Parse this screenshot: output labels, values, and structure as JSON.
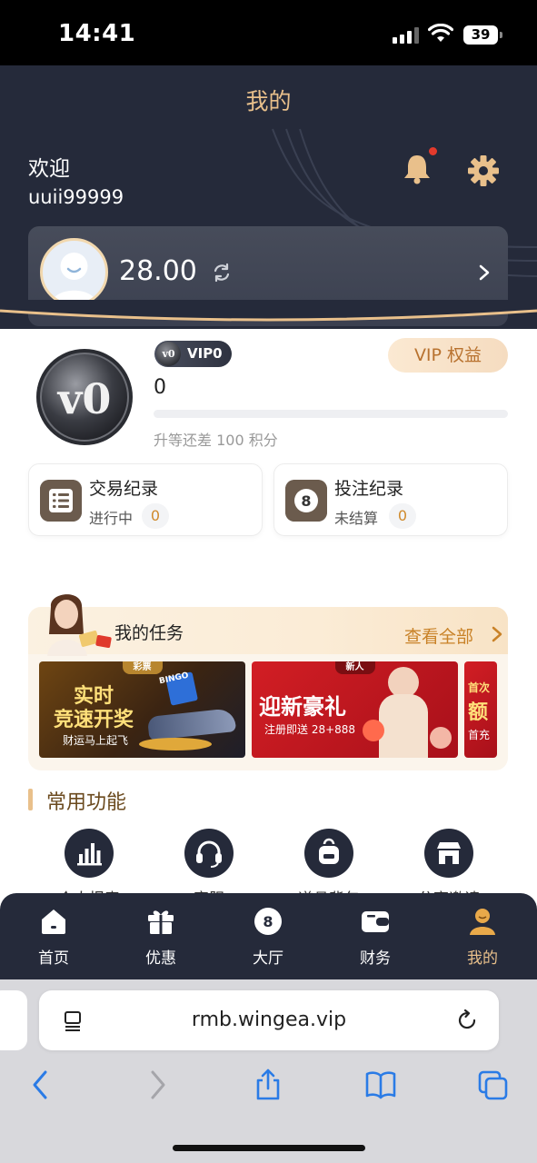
{
  "status_bar": {
    "time": "14:41",
    "battery": "39"
  },
  "header": {
    "title": "我的",
    "welcome": "欢迎",
    "username": "uuii99999",
    "balance": "28.00"
  },
  "vip": {
    "badge_level": "v0",
    "badge_label": "VIP0",
    "coin_label": "v0",
    "points": "0",
    "benefit_button": "VIP 权益",
    "progress_fraction": 0,
    "hint": "升等还差 100 积分"
  },
  "records": [
    {
      "title": "交易纪录",
      "status": "进行中",
      "count": "0"
    },
    {
      "title": "投注纪录",
      "status": "未结算",
      "count": "0"
    }
  ],
  "tasks": {
    "title": "我的任务",
    "view_all": "查看全部",
    "banners": [
      {
        "tag": "彩票",
        "line1": "实时",
        "line2": "竞速开奖",
        "sub": "财运马上起飞",
        "extra": "BINGO"
      },
      {
        "tag": "新人",
        "line1": "迎新豪礼",
        "sub": "注册即送 28+888"
      },
      {
        "tag": "首次",
        "line1": "额",
        "sub": "首充"
      }
    ]
  },
  "common_functions": {
    "title": "常用功能",
    "items": [
      {
        "icon": "chart-bar-icon",
        "label": "个人报表"
      },
      {
        "icon": "headset-icon",
        "label": "客服"
      },
      {
        "icon": "backpack-icon",
        "label": "道具背包"
      },
      {
        "icon": "shop-icon",
        "label": "分享邀请"
      }
    ]
  },
  "tabbar": {
    "items": [
      {
        "icon": "home-icon",
        "label": "首页",
        "active": false
      },
      {
        "icon": "gift-icon",
        "label": "优惠",
        "active": false
      },
      {
        "icon": "ball-8-icon",
        "label": "大厅",
        "active": false
      },
      {
        "icon": "wallet-icon",
        "label": "财务",
        "active": false
      },
      {
        "icon": "user-icon",
        "label": "我的",
        "active": true
      }
    ],
    "ball_number": "8"
  },
  "browser": {
    "url": "rmb.wingea.vip"
  },
  "colors": {
    "header_bg": "#252a3a",
    "gold": "#e9c08b",
    "accent_text": "#c98228",
    "notification": "#e33a2c"
  }
}
